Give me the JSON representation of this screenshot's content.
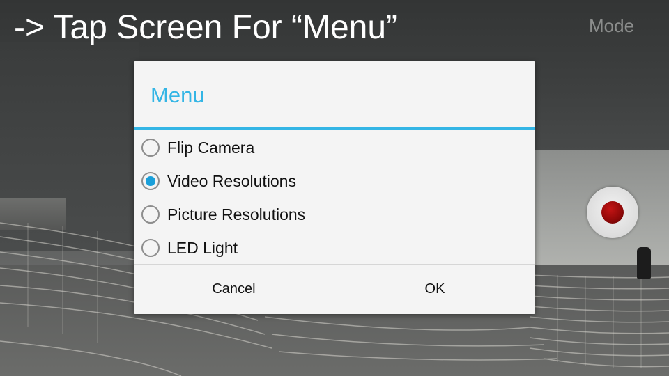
{
  "overlay": {
    "hint": "-> Tap Screen For “Menu”",
    "mode_label": "Mode"
  },
  "dialog": {
    "title": "Menu",
    "accent_color": "#33b5e5",
    "options": [
      {
        "label": "Flip Camera",
        "checked": false
      },
      {
        "label": "Video Resolutions",
        "checked": true
      },
      {
        "label": "Picture Resolutions",
        "checked": false
      },
      {
        "label": "LED Light",
        "checked": false
      }
    ],
    "cancel_label": "Cancel",
    "ok_label": "OK"
  },
  "controls": {
    "record_icon": "record-icon",
    "record_color": "#a00a0a"
  }
}
